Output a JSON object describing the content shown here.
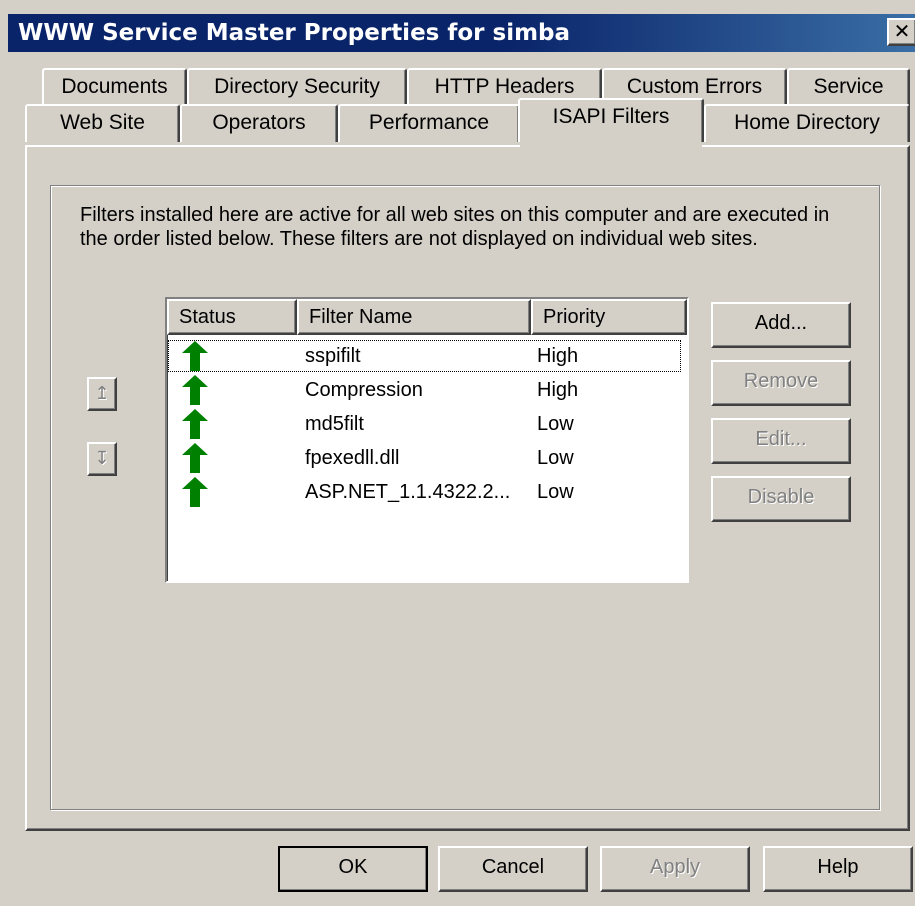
{
  "window": {
    "title": "WWW Service Master Properties for simba",
    "close_glyph": "✕"
  },
  "tabs": {
    "row1": [
      "Documents",
      "Directory Security",
      "HTTP Headers",
      "Custom Errors",
      "Service"
    ],
    "row2": [
      "Web Site",
      "Operators",
      "Performance",
      "ISAPI Filters",
      "Home Directory"
    ],
    "active": "ISAPI Filters"
  },
  "description": "Filters installed here are active for all web sites on this computer and are executed in the order listed below.  These filters are not displayed on individual web sites.",
  "list": {
    "columns": [
      "Status",
      "Filter Name",
      "Priority"
    ],
    "rows": [
      {
        "name": "sspifilt",
        "priority": "High",
        "status_icon": "green-up-arrow-icon"
      },
      {
        "name": "Compression",
        "priority": "High",
        "status_icon": "green-up-arrow-icon"
      },
      {
        "name": "md5filt",
        "priority": "Low",
        "status_icon": "green-up-arrow-icon"
      },
      {
        "name": "fpexedll.dll",
        "priority": "Low",
        "status_icon": "green-up-arrow-icon"
      },
      {
        "name": "ASP.NET_1.1.4322.2...",
        "priority": "Low",
        "status_icon": "green-up-arrow-icon"
      }
    ],
    "selected_index": 0
  },
  "side_buttons": {
    "add": "Add...",
    "remove": "Remove",
    "edit": "Edit...",
    "disable": "Disable"
  },
  "order_buttons": {
    "up": "↥",
    "down": "↧"
  },
  "footer": {
    "ok": "OK",
    "cancel": "Cancel",
    "apply": "Apply",
    "help": "Help"
  },
  "colors": {
    "titlebar": "#0a246a",
    "face": "#d4d0c8",
    "status_arrow": "#008000"
  }
}
